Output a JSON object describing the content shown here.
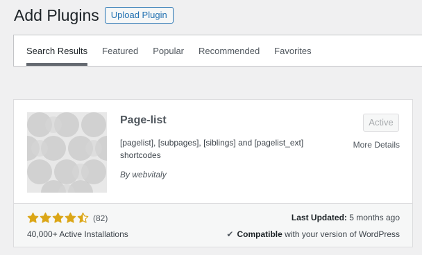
{
  "header": {
    "title": "Add Plugins",
    "upload_label": "Upload Plugin"
  },
  "tabs": [
    {
      "label": "Search Results",
      "current": true
    },
    {
      "label": "Featured"
    },
    {
      "label": "Popular"
    },
    {
      "label": "Recommended"
    },
    {
      "label": "Favorites"
    }
  ],
  "plugin": {
    "name": "Page-list",
    "description": "[pagelist], [subpages], [siblings] and [pagelist_ext] shortcodes",
    "author_prefix": "By",
    "author": "webvitaly",
    "action_label": "Active",
    "more_details": "More Details",
    "rating_value": 4.5,
    "rating_max": 5,
    "num_ratings": "(82)",
    "installs": "40,000+ Active Installations",
    "last_updated_label": "Last Updated:",
    "last_updated_value": "5 months ago",
    "compat_strong": "Compatible",
    "compat_rest": "with your version of WordPress",
    "icon": "plugin-banner-circles"
  },
  "colors": {
    "star": "#dba617",
    "link": "#2271b1",
    "background": "#f0f0f1"
  }
}
